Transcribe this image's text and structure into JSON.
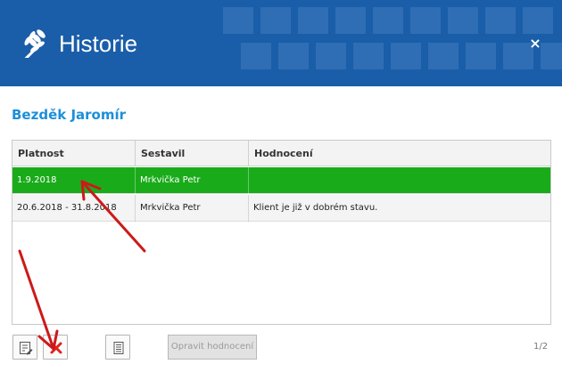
{
  "header": {
    "title": "Historie",
    "close_label": "×",
    "bg_color": "#1a5ea9",
    "icon": "wheat-icon"
  },
  "person": {
    "name": "Bezděk Jaromír",
    "color": "#1c8fd9"
  },
  "grid": {
    "columns": [
      "Platnost",
      "Sestavil",
      "Hodnocení"
    ],
    "rows": [
      {
        "platnost": "1.9.2018",
        "sestavil": "Mrkvička Petr",
        "hodnoceni": "",
        "selected": true
      },
      {
        "platnost": "20.6.2018 - 31.8.2018",
        "sestavil": "Mrkvička Petr",
        "hodnoceni": "Klient je již v dobrém stavu.",
        "selected": false
      }
    ],
    "selected_color": "#1aab1a"
  },
  "toolbar": {
    "edit_icon": "edit-icon",
    "delete_icon": "delete-icon",
    "document_icon": "document-icon",
    "fix_label": "Opravit hodnocení",
    "pager": "1/2"
  },
  "annotations": {
    "arrow_color": "#cc1a1a"
  }
}
